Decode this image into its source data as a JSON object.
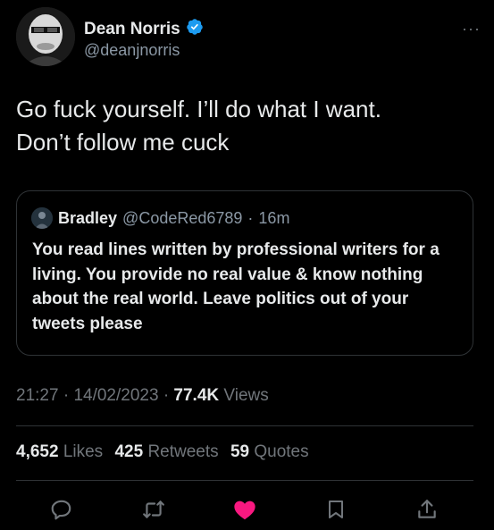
{
  "author": {
    "display_name": "Dean Norris",
    "handle": "@deanjnorris",
    "verified": true,
    "more_label": "···"
  },
  "tweet": {
    "text_line_1": "Go fuck yourself. I’ll do what I want.",
    "text_line_2": "Don’t follow me cuck"
  },
  "quoted_tweet": {
    "display_name": "Bradley",
    "handle": "@CodeRed6789",
    "separator": "·",
    "time_ago": "16m",
    "text": "You read lines written by professional writers for a living. You provide no real value & know nothing about the real world. Leave politics out of your tweets please"
  },
  "meta": {
    "time": "21:27",
    "date": "14/02/2023",
    "separator": "·",
    "views_count": "77.4K",
    "views_label": "Views"
  },
  "stats": {
    "likes_count": "4,652",
    "likes_label": "Likes",
    "retweets_count": "425",
    "retweets_label": "Retweets",
    "quotes_count": "59",
    "quotes_label": "Quotes"
  },
  "actions": [
    "reply-icon",
    "retweet-icon",
    "like-icon",
    "bookmark-icon",
    "share-icon"
  ],
  "colors": {
    "background": "#000000",
    "text_primary": "#e7e9ea",
    "text_secondary": "#71767b",
    "verified_blue": "#1d9bf0",
    "like_pink": "#f91880",
    "border": "#2f3336"
  }
}
